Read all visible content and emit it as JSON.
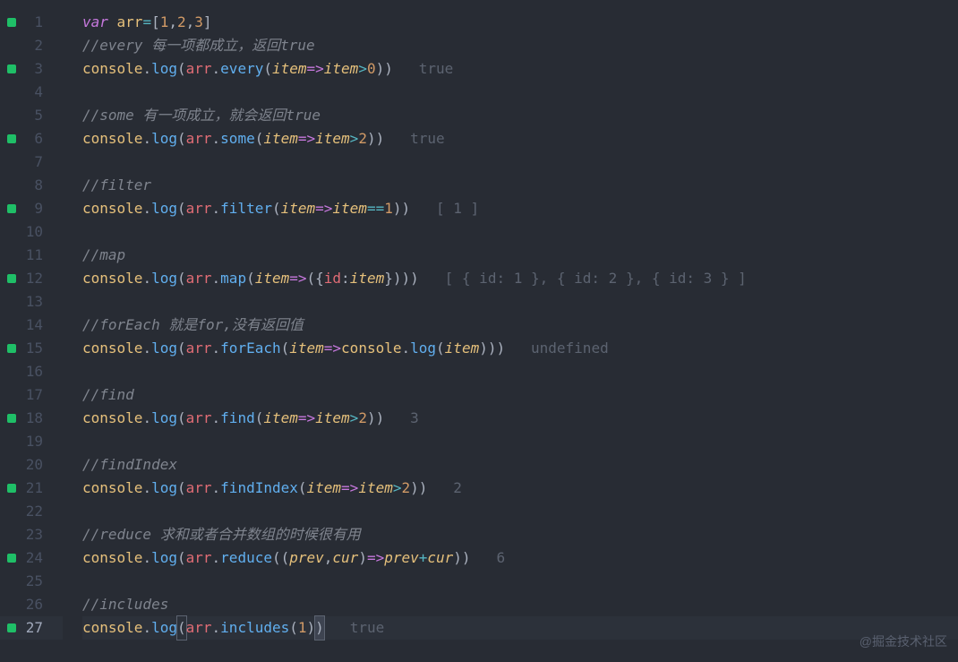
{
  "watermark": "@掘金技术社区",
  "current_line": 27,
  "lines": [
    {
      "n": 1,
      "marker": true,
      "tokens": [
        {
          "t": "var ",
          "c": "tok-kw"
        },
        {
          "t": "arr",
          "c": "tok-var"
        },
        {
          "t": "=",
          "c": "tok-op"
        },
        {
          "t": "[",
          "c": "tok-punc"
        },
        {
          "t": "1",
          "c": "tok-num"
        },
        {
          "t": ",",
          "c": "tok-punc"
        },
        {
          "t": "2",
          "c": "tok-num"
        },
        {
          "t": ",",
          "c": "tok-punc"
        },
        {
          "t": "3",
          "c": "tok-num"
        },
        {
          "t": "]",
          "c": "tok-punc"
        }
      ]
    },
    {
      "n": 2,
      "marker": false,
      "tokens": [
        {
          "t": "//every 每一项都成立，返回true",
          "c": "tok-comment"
        }
      ]
    },
    {
      "n": 3,
      "marker": true,
      "tokens": [
        {
          "t": "console",
          "c": "tok-var"
        },
        {
          "t": ".",
          "c": "tok-punc"
        },
        {
          "t": "log",
          "c": "tok-func"
        },
        {
          "t": "(",
          "c": "tok-punc"
        },
        {
          "t": "arr",
          "c": "tok-ident"
        },
        {
          "t": ".",
          "c": "tok-punc"
        },
        {
          "t": "every",
          "c": "tok-func"
        },
        {
          "t": "(",
          "c": "tok-punc"
        },
        {
          "t": "item",
          "c": "tok-param"
        },
        {
          "t": "=>",
          "c": "tok-kw"
        },
        {
          "t": "item",
          "c": "tok-param"
        },
        {
          "t": ">",
          "c": "tok-op"
        },
        {
          "t": "0",
          "c": "tok-num"
        },
        {
          "t": "))",
          "c": "tok-punc"
        },
        {
          "t": "   true",
          "c": "tok-result"
        }
      ]
    },
    {
      "n": 4,
      "marker": false,
      "tokens": []
    },
    {
      "n": 5,
      "marker": false,
      "tokens": [
        {
          "t": "//some 有一项成立，就会返回true",
          "c": "tok-comment"
        }
      ]
    },
    {
      "n": 6,
      "marker": true,
      "tokens": [
        {
          "t": "console",
          "c": "tok-var"
        },
        {
          "t": ".",
          "c": "tok-punc"
        },
        {
          "t": "log",
          "c": "tok-func"
        },
        {
          "t": "(",
          "c": "tok-punc"
        },
        {
          "t": "arr",
          "c": "tok-ident"
        },
        {
          "t": ".",
          "c": "tok-punc"
        },
        {
          "t": "some",
          "c": "tok-func"
        },
        {
          "t": "(",
          "c": "tok-punc"
        },
        {
          "t": "item",
          "c": "tok-param"
        },
        {
          "t": "=>",
          "c": "tok-kw"
        },
        {
          "t": "item",
          "c": "tok-param"
        },
        {
          "t": ">",
          "c": "tok-op"
        },
        {
          "t": "2",
          "c": "tok-num"
        },
        {
          "t": "))",
          "c": "tok-punc"
        },
        {
          "t": "   true",
          "c": "tok-result"
        }
      ]
    },
    {
      "n": 7,
      "marker": false,
      "tokens": []
    },
    {
      "n": 8,
      "marker": false,
      "tokens": [
        {
          "t": "//filter",
          "c": "tok-comment"
        }
      ]
    },
    {
      "n": 9,
      "marker": true,
      "tokens": [
        {
          "t": "console",
          "c": "tok-var"
        },
        {
          "t": ".",
          "c": "tok-punc"
        },
        {
          "t": "log",
          "c": "tok-func"
        },
        {
          "t": "(",
          "c": "tok-punc"
        },
        {
          "t": "arr",
          "c": "tok-ident"
        },
        {
          "t": ".",
          "c": "tok-punc"
        },
        {
          "t": "filter",
          "c": "tok-func"
        },
        {
          "t": "(",
          "c": "tok-punc"
        },
        {
          "t": "item",
          "c": "tok-param"
        },
        {
          "t": "=>",
          "c": "tok-kw"
        },
        {
          "t": "item",
          "c": "tok-param"
        },
        {
          "t": "==",
          "c": "tok-op"
        },
        {
          "t": "1",
          "c": "tok-num"
        },
        {
          "t": "))",
          "c": "tok-punc"
        },
        {
          "t": "   [ 1 ]",
          "c": "tok-result"
        }
      ]
    },
    {
      "n": 10,
      "marker": false,
      "tokens": []
    },
    {
      "n": 11,
      "marker": false,
      "tokens": [
        {
          "t": "//map",
          "c": "tok-comment"
        }
      ]
    },
    {
      "n": 12,
      "marker": true,
      "tokens": [
        {
          "t": "console",
          "c": "tok-var"
        },
        {
          "t": ".",
          "c": "tok-punc"
        },
        {
          "t": "log",
          "c": "tok-func"
        },
        {
          "t": "(",
          "c": "tok-punc"
        },
        {
          "t": "arr",
          "c": "tok-ident"
        },
        {
          "t": ".",
          "c": "tok-punc"
        },
        {
          "t": "map",
          "c": "tok-func"
        },
        {
          "t": "(",
          "c": "tok-punc"
        },
        {
          "t": "item",
          "c": "tok-param"
        },
        {
          "t": "=>",
          "c": "tok-kw"
        },
        {
          "t": "({",
          "c": "tok-punc"
        },
        {
          "t": "id",
          "c": "tok-ident"
        },
        {
          "t": ":",
          "c": "tok-punc"
        },
        {
          "t": "item",
          "c": "tok-param"
        },
        {
          "t": "})))",
          "c": "tok-punc"
        },
        {
          "t": "   [ { id: 1 }, { id: 2 }, { id: 3 } ]",
          "c": "tok-result"
        }
      ]
    },
    {
      "n": 13,
      "marker": false,
      "tokens": []
    },
    {
      "n": 14,
      "marker": false,
      "tokens": [
        {
          "t": "//forEach 就是for,没有返回值",
          "c": "tok-comment"
        }
      ]
    },
    {
      "n": 15,
      "marker": true,
      "tokens": [
        {
          "t": "console",
          "c": "tok-var"
        },
        {
          "t": ".",
          "c": "tok-punc"
        },
        {
          "t": "log",
          "c": "tok-func"
        },
        {
          "t": "(",
          "c": "tok-punc"
        },
        {
          "t": "arr",
          "c": "tok-ident"
        },
        {
          "t": ".",
          "c": "tok-punc"
        },
        {
          "t": "forEach",
          "c": "tok-func"
        },
        {
          "t": "(",
          "c": "tok-punc"
        },
        {
          "t": "item",
          "c": "tok-param"
        },
        {
          "t": "=>",
          "c": "tok-kw"
        },
        {
          "t": "console",
          "c": "tok-var"
        },
        {
          "t": ".",
          "c": "tok-punc"
        },
        {
          "t": "log",
          "c": "tok-func"
        },
        {
          "t": "(",
          "c": "tok-punc"
        },
        {
          "t": "item",
          "c": "tok-param"
        },
        {
          "t": ")))",
          "c": "tok-punc"
        },
        {
          "t": "   undefined",
          "c": "tok-result"
        }
      ]
    },
    {
      "n": 16,
      "marker": false,
      "tokens": []
    },
    {
      "n": 17,
      "marker": false,
      "tokens": [
        {
          "t": "//find",
          "c": "tok-comment"
        }
      ]
    },
    {
      "n": 18,
      "marker": true,
      "tokens": [
        {
          "t": "console",
          "c": "tok-var"
        },
        {
          "t": ".",
          "c": "tok-punc"
        },
        {
          "t": "log",
          "c": "tok-func"
        },
        {
          "t": "(",
          "c": "tok-punc"
        },
        {
          "t": "arr",
          "c": "tok-ident"
        },
        {
          "t": ".",
          "c": "tok-punc"
        },
        {
          "t": "find",
          "c": "tok-func"
        },
        {
          "t": "(",
          "c": "tok-punc"
        },
        {
          "t": "item",
          "c": "tok-param"
        },
        {
          "t": "=>",
          "c": "tok-kw"
        },
        {
          "t": "item",
          "c": "tok-param"
        },
        {
          "t": ">",
          "c": "tok-op"
        },
        {
          "t": "2",
          "c": "tok-num"
        },
        {
          "t": "))",
          "c": "tok-punc"
        },
        {
          "t": "   3",
          "c": "tok-result"
        }
      ]
    },
    {
      "n": 19,
      "marker": false,
      "tokens": []
    },
    {
      "n": 20,
      "marker": false,
      "tokens": [
        {
          "t": "//findIndex",
          "c": "tok-comment"
        }
      ]
    },
    {
      "n": 21,
      "marker": true,
      "tokens": [
        {
          "t": "console",
          "c": "tok-var"
        },
        {
          "t": ".",
          "c": "tok-punc"
        },
        {
          "t": "log",
          "c": "tok-func"
        },
        {
          "t": "(",
          "c": "tok-punc"
        },
        {
          "t": "arr",
          "c": "tok-ident"
        },
        {
          "t": ".",
          "c": "tok-punc"
        },
        {
          "t": "findIndex",
          "c": "tok-func"
        },
        {
          "t": "(",
          "c": "tok-punc"
        },
        {
          "t": "item",
          "c": "tok-param"
        },
        {
          "t": "=>",
          "c": "tok-kw"
        },
        {
          "t": "item",
          "c": "tok-param"
        },
        {
          "t": ">",
          "c": "tok-op"
        },
        {
          "t": "2",
          "c": "tok-num"
        },
        {
          "t": "))",
          "c": "tok-punc"
        },
        {
          "t": "   2",
          "c": "tok-result"
        }
      ]
    },
    {
      "n": 22,
      "marker": false,
      "tokens": []
    },
    {
      "n": 23,
      "marker": false,
      "tokens": [
        {
          "t": "//reduce 求和或者合并数组的时候很有用",
          "c": "tok-comment"
        }
      ]
    },
    {
      "n": 24,
      "marker": true,
      "tokens": [
        {
          "t": "console",
          "c": "tok-var"
        },
        {
          "t": ".",
          "c": "tok-punc"
        },
        {
          "t": "log",
          "c": "tok-func"
        },
        {
          "t": "(",
          "c": "tok-punc"
        },
        {
          "t": "arr",
          "c": "tok-ident"
        },
        {
          "t": ".",
          "c": "tok-punc"
        },
        {
          "t": "reduce",
          "c": "tok-func"
        },
        {
          "t": "((",
          "c": "tok-punc"
        },
        {
          "t": "prev",
          "c": "tok-param"
        },
        {
          "t": ",",
          "c": "tok-punc"
        },
        {
          "t": "cur",
          "c": "tok-param"
        },
        {
          "t": ")",
          "c": "tok-punc"
        },
        {
          "t": "=>",
          "c": "tok-kw"
        },
        {
          "t": "prev",
          "c": "tok-param"
        },
        {
          "t": "+",
          "c": "tok-op"
        },
        {
          "t": "cur",
          "c": "tok-param"
        },
        {
          "t": "))",
          "c": "tok-punc"
        },
        {
          "t": "   6",
          "c": "tok-result"
        }
      ]
    },
    {
      "n": 25,
      "marker": false,
      "tokens": []
    },
    {
      "n": 26,
      "marker": false,
      "tokens": [
        {
          "t": "//includes",
          "c": "tok-comment"
        }
      ]
    },
    {
      "n": 27,
      "marker": true,
      "tokens": [
        {
          "t": "console",
          "c": "tok-var"
        },
        {
          "t": ".",
          "c": "tok-punc"
        },
        {
          "t": "log",
          "c": "tok-func"
        },
        {
          "t": "(",
          "c": "tok-punc bracket-hl"
        },
        {
          "t": "arr",
          "c": "tok-ident"
        },
        {
          "t": ".",
          "c": "tok-punc"
        },
        {
          "t": "includes",
          "c": "tok-func"
        },
        {
          "t": "(",
          "c": "tok-punc"
        },
        {
          "t": "1",
          "c": "tok-num"
        },
        {
          "t": ")",
          "c": "tok-punc"
        },
        {
          "t": ")",
          "c": "tok-punc bracket-hl cursor-hl"
        },
        {
          "t": "   true",
          "c": "tok-result"
        }
      ]
    }
  ]
}
